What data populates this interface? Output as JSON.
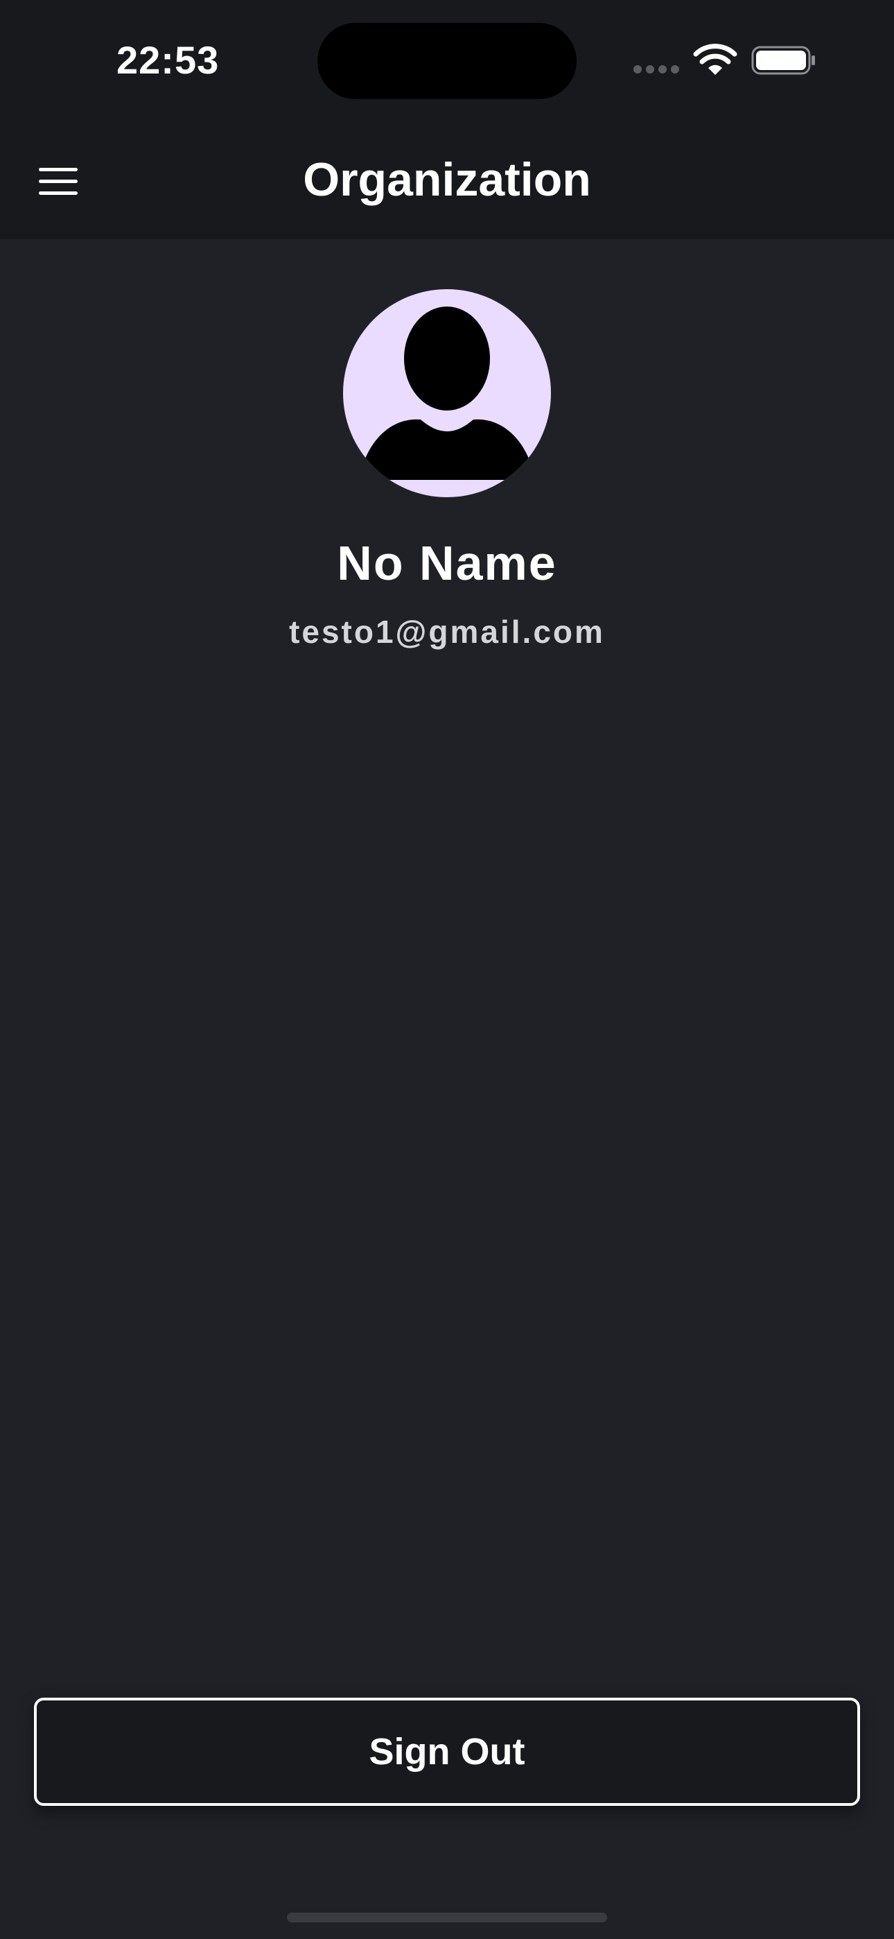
{
  "status_bar": {
    "time": "22:53",
    "icons": [
      "signal-icon",
      "wifi-icon",
      "battery-icon"
    ]
  },
  "header": {
    "title": "Organization",
    "menu_icon": "menu-icon"
  },
  "profile": {
    "avatar_icon": "person-icon",
    "name": "No Name",
    "email": "testo1@gmail.com"
  },
  "actions": {
    "sign_out_label": "Sign Out"
  },
  "colors": {
    "background": "#202127",
    "header_background": "#18191d",
    "avatar_background": "#eadcff",
    "text_primary": "#ffffff",
    "text_secondary": "#d5d6da"
  }
}
